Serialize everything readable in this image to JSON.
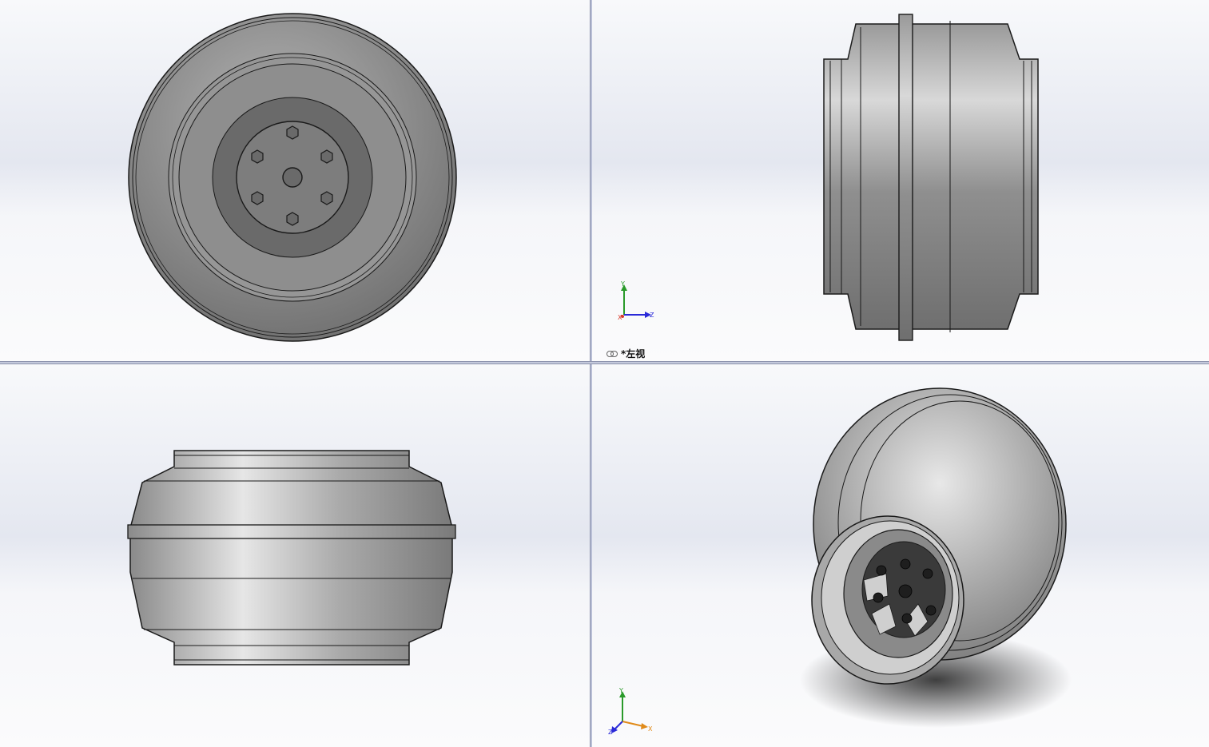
{
  "viewports": {
    "top_right": {
      "view_label": "*左视",
      "triad": {
        "y": "Y",
        "z": "Z",
        "x": "X"
      }
    },
    "bottom_right": {
      "triad": {
        "y": "Y",
        "x": "X",
        "z": "Z"
      }
    }
  },
  "colors": {
    "part_gray": "#8c8c8c",
    "hub_dark": "#5a5a5a",
    "edge": "#1a1a1a",
    "axis_x": "#d83a2a",
    "axis_y": "#2a9a2a",
    "axis_z": "#2a2ad8",
    "axis_x_iso": "#e08a1a"
  },
  "icons": [
    "link-icon",
    "triad-icon"
  ]
}
